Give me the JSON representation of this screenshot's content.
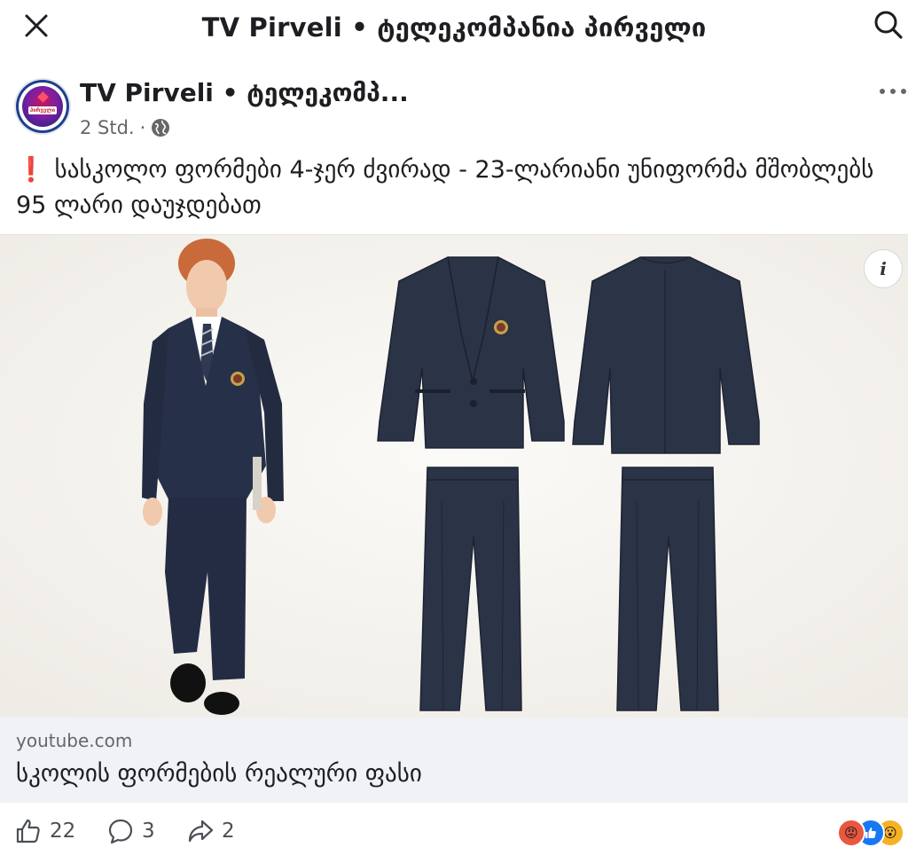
{
  "topbar": {
    "title": "TV Pirveli • ტელეკომპანია პირველი",
    "close_icon": "close-icon",
    "search_icon": "search-icon"
  },
  "post": {
    "page_name": "TV Pirveli • ტელეკომპ...",
    "avatar_text": "პირველი",
    "time": "2 Std.",
    "separator": "·",
    "privacy_icon": "globe-icon",
    "more_icon": "more-horizontal-icon",
    "text_icon": "❗",
    "text": "სასკოლო ფორმები 4-ჯერ ძვირად - 23-ლარიანი უნიფორმა მშობლებს 95 ლარი დაუჯდებათ"
  },
  "media": {
    "info_label": "i",
    "colors": {
      "navy": "#2b3446",
      "background": "#f4f2ee"
    }
  },
  "link_preview": {
    "domain": "youtube.com",
    "title": "სკოლის ფორმების რეალური ფასი"
  },
  "actions": {
    "likes": "22",
    "comments": "3",
    "shares": "2",
    "reaction_icons": [
      "angry-icon",
      "like-icon",
      "wow-icon"
    ]
  }
}
